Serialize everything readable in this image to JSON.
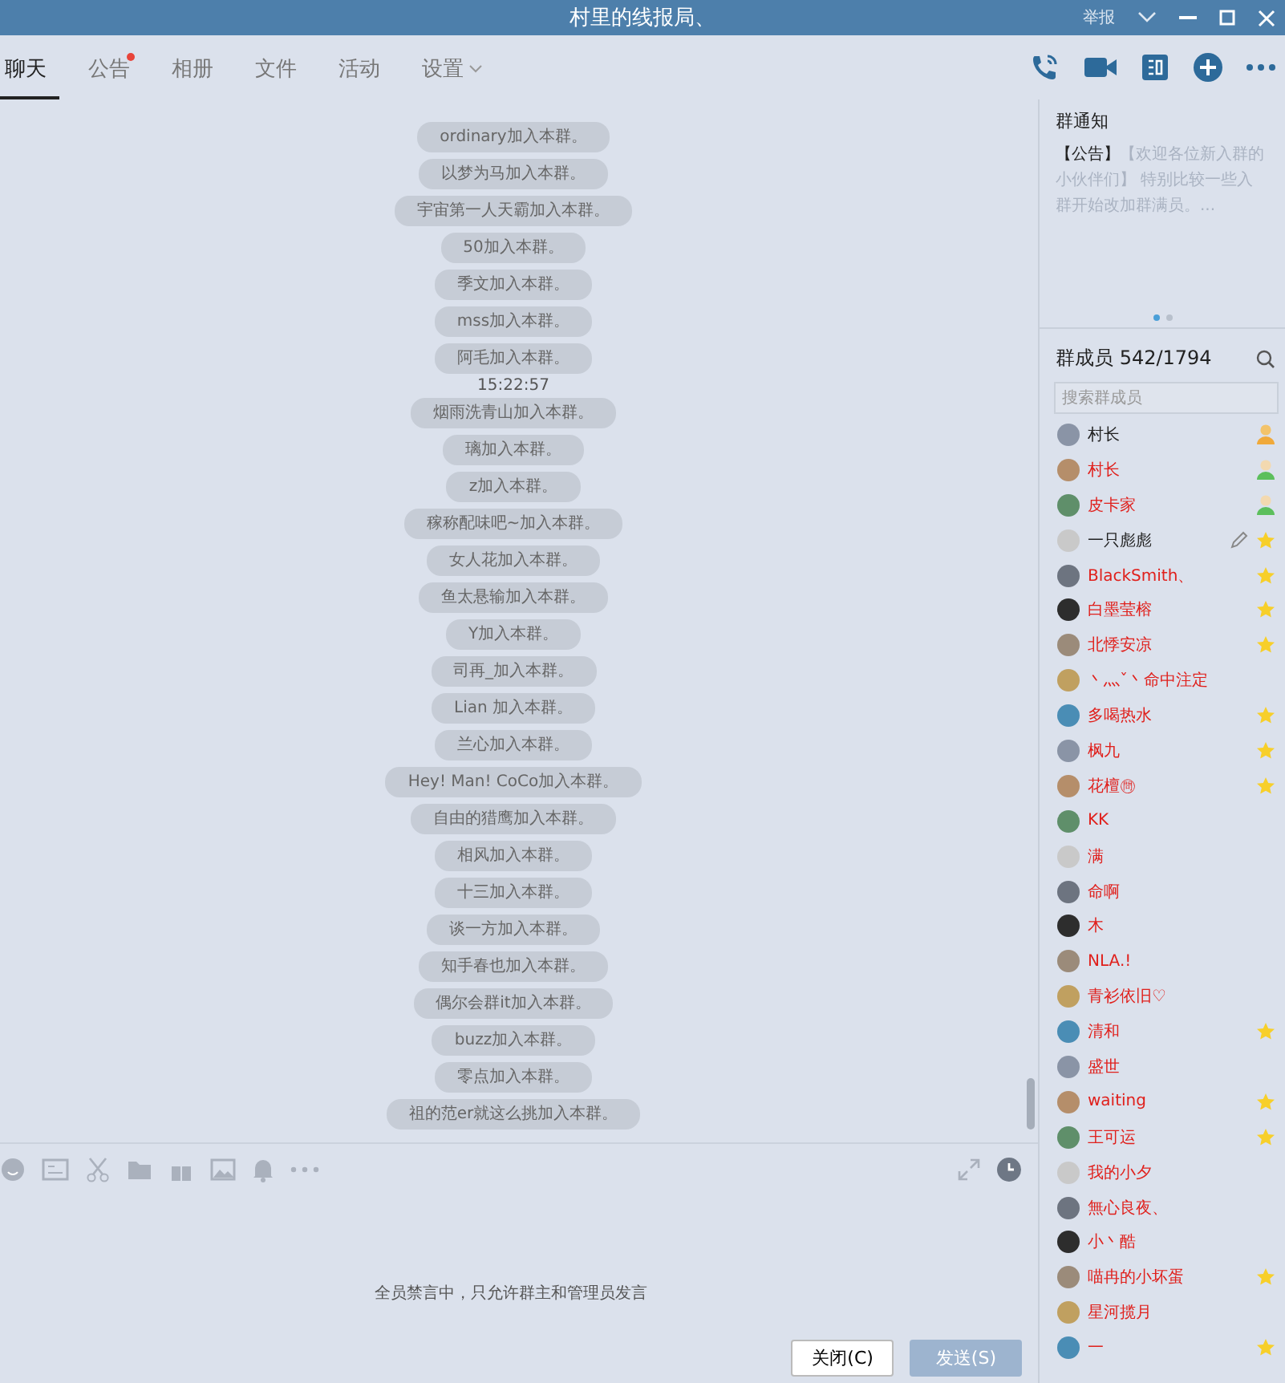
{
  "window": {
    "title": "村里的线报局、",
    "report": "举报"
  },
  "tabs": [
    {
      "label": "聊天",
      "selected": true,
      "dot": false,
      "caret": false
    },
    {
      "label": "公告",
      "selected": false,
      "dot": true,
      "caret": false
    },
    {
      "label": "相册",
      "selected": false,
      "dot": false,
      "caret": false
    },
    {
      "label": "文件",
      "selected": false,
      "dot": false,
      "caret": false
    },
    {
      "label": "活动",
      "selected": false,
      "dot": false,
      "caret": false
    },
    {
      "label": "设置",
      "selected": false,
      "dot": false,
      "caret": true
    }
  ],
  "messages": [
    {
      "kind": "join",
      "text": "ordinary加入本群。"
    },
    {
      "kind": "join",
      "text": "以梦为马加入本群。"
    },
    {
      "kind": "join",
      "text": "宇宙第一人天霸加入本群。"
    },
    {
      "kind": "join",
      "text": "50加入本群。"
    },
    {
      "kind": "join",
      "text": "季文加入本群。"
    },
    {
      "kind": "join",
      "text": "mss加入本群。"
    },
    {
      "kind": "join",
      "text": "阿毛加入本群。"
    },
    {
      "kind": "time",
      "text": "15:22:57"
    },
    {
      "kind": "join",
      "text": "烟雨洗青山加入本群。"
    },
    {
      "kind": "join",
      "text": "璃加入本群。"
    },
    {
      "kind": "join",
      "text": "z加入本群。"
    },
    {
      "kind": "join",
      "text": "稼称配味吧~加入本群。"
    },
    {
      "kind": "join",
      "text": "女人花加入本群。"
    },
    {
      "kind": "join",
      "text": "鱼太悬输加入本群。"
    },
    {
      "kind": "join",
      "text": "Y加入本群。"
    },
    {
      "kind": "join",
      "text": "司再_加入本群。"
    },
    {
      "kind": "join",
      "text": "Lian 加入本群。"
    },
    {
      "kind": "join",
      "text": "兰心加入本群。"
    },
    {
      "kind": "join",
      "text": "Hey! Man! CoCo加入本群。"
    },
    {
      "kind": "join",
      "text": "自由的猎鹰加入本群。"
    },
    {
      "kind": "join",
      "text": "相风加入本群。"
    },
    {
      "kind": "join",
      "text": "十三加入本群。"
    },
    {
      "kind": "join",
      "text": "谈一方加入本群。"
    },
    {
      "kind": "join",
      "text": "知手春也加入本群。"
    },
    {
      "kind": "join",
      "text": "偶尔会群it加入本群。"
    },
    {
      "kind": "join",
      "text": "buzz加入本群。"
    },
    {
      "kind": "join",
      "text": "零点加入本群。"
    },
    {
      "kind": "join",
      "text": "祖的范er就这么挑加入本群。"
    }
  ],
  "composer": {
    "notice": "全员禁言中，只允许群主和管理员发言",
    "buttons": [
      {
        "label": "关闭(C)",
        "kind": "close"
      },
      {
        "label": "发送(S)",
        "kind": "send"
      }
    ]
  },
  "announcement": {
    "title": "群通知",
    "tag": "【公告】",
    "text": "【欢迎各位新入群的小伙伴们】 特别比较一些入群开始改加群满员。...",
    "pages": [
      {
        "selected": true
      },
      {
        "selected": false
      }
    ]
  },
  "members": {
    "title": "群成员 542/1794",
    "search": {
      "placeholder": "搜索群成员"
    },
    "list": [
      {
        "name": "村长",
        "color": "#222222",
        "kind": "owner"
      },
      {
        "name": "村长",
        "color": "#e0201c",
        "kind": "admin"
      },
      {
        "name": "皮卡家",
        "color": "#e0201c",
        "kind": "admin"
      },
      {
        "name": "一只彪彪",
        "color": "#222222",
        "kind": "star",
        "editable": true
      },
      {
        "name": "BlackSmith、",
        "color": "#e0201c",
        "kind": "star"
      },
      {
        "name": "白墨莹榕",
        "color": "#e0201c",
        "kind": "star"
      },
      {
        "name": "北悸安凉",
        "color": "#e0201c",
        "kind": "star"
      },
      {
        "name": "丶灬ˇ丶命中注定",
        "color": "#e0201c",
        "kind": "none"
      },
      {
        "name": "多喝热水",
        "color": "#e0201c",
        "kind": "star"
      },
      {
        "name": "枫九",
        "color": "#e0201c",
        "kind": "star"
      },
      {
        "name": "花檀㉄",
        "color": "#e0201c",
        "kind": "star"
      },
      {
        "name": "KK",
        "color": "#e0201c",
        "kind": "none"
      },
      {
        "name": "满",
        "color": "#e0201c",
        "kind": "none"
      },
      {
        "name": "命啊",
        "color": "#e0201c",
        "kind": "none"
      },
      {
        "name": "木",
        "color": "#e0201c",
        "kind": "none"
      },
      {
        "name": "NLA.!",
        "color": "#e0201c",
        "kind": "none"
      },
      {
        "name": "青衫依旧♡",
        "color": "#e0201c",
        "kind": "none"
      },
      {
        "name": "清和",
        "color": "#e0201c",
        "kind": "star"
      },
      {
        "name": "盛世",
        "color": "#e0201c",
        "kind": "none"
      },
      {
        "name": "waiting",
        "color": "#e0201c",
        "kind": "star"
      },
      {
        "name": "王可运",
        "color": "#e0201c",
        "kind": "star"
      },
      {
        "name": "我的小夕",
        "color": "#e0201c",
        "kind": "none"
      },
      {
        "name": "無心良夜、",
        "color": "#e0201c",
        "kind": "none"
      },
      {
        "name": "小丶酷",
        "color": "#e0201c",
        "kind": "none"
      },
      {
        "name": "喵冉的小坏蛋",
        "color": "#e0201c",
        "kind": "star"
      },
      {
        "name": "星河揽月",
        "color": "#e0201c",
        "kind": "none"
      },
      {
        "name": "一",
        "color": "#e0201c",
        "kind": "star"
      }
    ]
  }
}
